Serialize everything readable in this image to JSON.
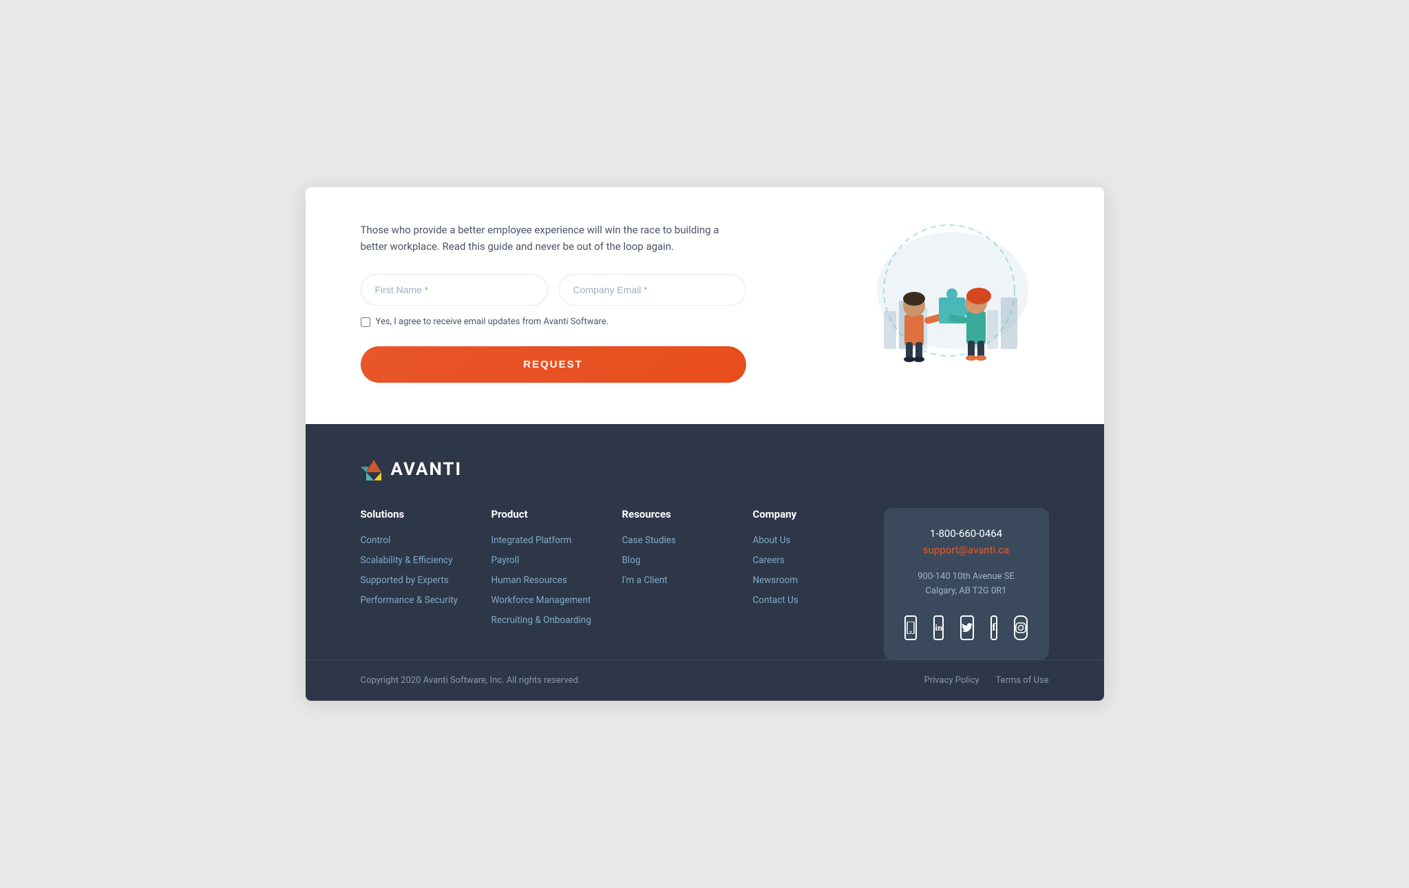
{
  "form": {
    "description": "Those who provide a better employee experience will win the race to building a better workplace. Read this guide and never be out of the loop again.",
    "first_name_placeholder": "First Name *",
    "company_email_placeholder": "Company Email *",
    "checkbox_label": "Yes, I agree to receive email updates from Avanti Software.",
    "request_button_label": "REQUEST"
  },
  "footer": {
    "logo_text": "AVANTI",
    "columns": {
      "solutions": {
        "heading": "Solutions",
        "links": [
          "Control",
          "Scalability & Efficiency",
          "Supported by Experts",
          "Performance & Security"
        ]
      },
      "product": {
        "heading": "Product",
        "links": [
          "Integrated Platform",
          "Payroll",
          "Human Resources",
          "Workforce Management",
          "Recruiting & Onboarding"
        ]
      },
      "resources": {
        "heading": "Resources",
        "links": [
          "Case Studies",
          "Blog",
          "I'm a Client"
        ]
      },
      "company": {
        "heading": "Company",
        "links": [
          "About Us",
          "Careers",
          "Newsroom",
          "Contact Us"
        ]
      }
    },
    "contact": {
      "phone": "1-800-660-0464",
      "email": "support@avanti.ca",
      "address_line1": "900-140 10th Avenue SE",
      "address_line2": "Calgary, AB T2G 0R1"
    },
    "social": [
      {
        "name": "mobile-icon",
        "symbol": "📱"
      },
      {
        "name": "linkedin-icon",
        "symbol": "in"
      },
      {
        "name": "twitter-icon",
        "symbol": "🐦"
      },
      {
        "name": "facebook-icon",
        "symbol": "f"
      },
      {
        "name": "instagram-icon",
        "symbol": "◎"
      }
    ],
    "bottom": {
      "copyright": "Copyright 2020 Avanti Software, Inc. All rights reserved.",
      "privacy_policy": "Privacy Policy",
      "terms_of_use": "Terms of Use"
    }
  }
}
